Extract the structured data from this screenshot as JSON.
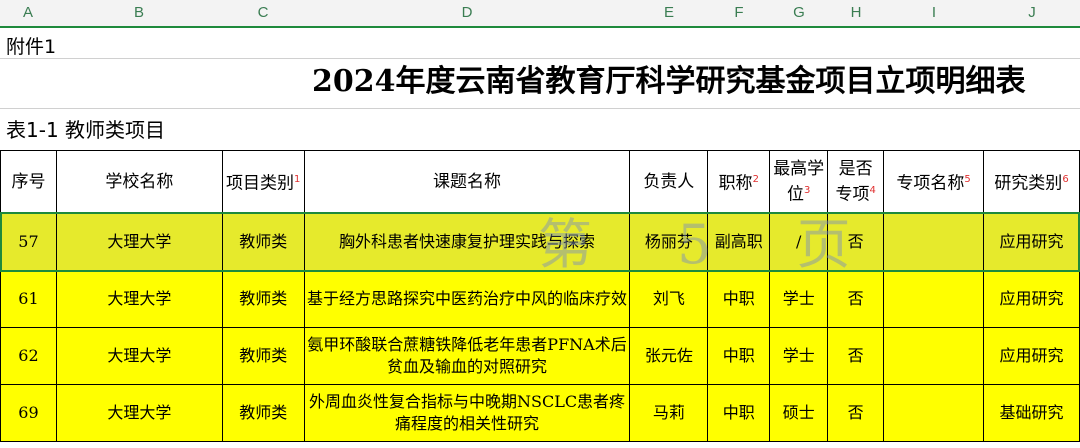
{
  "column_headers": [
    "A",
    "B",
    "C",
    "D",
    "E",
    "F",
    "G",
    "H",
    "I",
    "J"
  ],
  "attachment_label": "附件1",
  "title": "2024年度云南省教育厅科学研究基金项目立项明细表",
  "table_label": "表1-1  教师类项目",
  "table": {
    "headers": [
      {
        "text": "序号",
        "sup": ""
      },
      {
        "text": "学校名称",
        "sup": ""
      },
      {
        "text": "项目类别",
        "sup": "1"
      },
      {
        "text": "课题名称",
        "sup": ""
      },
      {
        "text": "负责人",
        "sup": ""
      },
      {
        "text": "职称",
        "sup": "2"
      },
      {
        "text": "最高学位",
        "sup": "3"
      },
      {
        "text": "是否专项",
        "sup": "4"
      },
      {
        "text": "专项名称",
        "sup": "5"
      },
      {
        "text": "研究类别",
        "sup": "6"
      }
    ],
    "rows": [
      {
        "no": "57",
        "school": "大理大学",
        "category": "教师类",
        "topic": "胸外科患者快速康复护理实践与探索",
        "leader": "杨丽芬",
        "title": "副高职",
        "degree": "/",
        "special": "否",
        "special_name": "",
        "research_type": "应用研究"
      },
      {
        "no": "61",
        "school": "大理大学",
        "category": "教师类",
        "topic": "基于经方思路探究中医药治疗中风的临床疗效",
        "leader": "刘飞",
        "title": "中职",
        "degree": "学士",
        "special": "否",
        "special_name": "",
        "research_type": "应用研究"
      },
      {
        "no": "62",
        "school": "大理大学",
        "category": "教师类",
        "topic": "氨甲环酸联合蔗糖铁降低老年患者PFNA术后贫血及输血的对照研究",
        "leader": "张元佐",
        "title": "中职",
        "degree": "学士",
        "special": "否",
        "special_name": "",
        "research_type": "应用研究"
      },
      {
        "no": "69",
        "school": "大理大学",
        "category": "教师类",
        "topic": "外周血炎性复合指标与中晚期NSCLC患者疼痛程度的相关性研究",
        "leader": "马莉",
        "title": "中职",
        "degree": "硕士",
        "special": "否",
        "special_name": "",
        "research_type": "基础研究"
      }
    ]
  },
  "watermark": "第 5 页"
}
